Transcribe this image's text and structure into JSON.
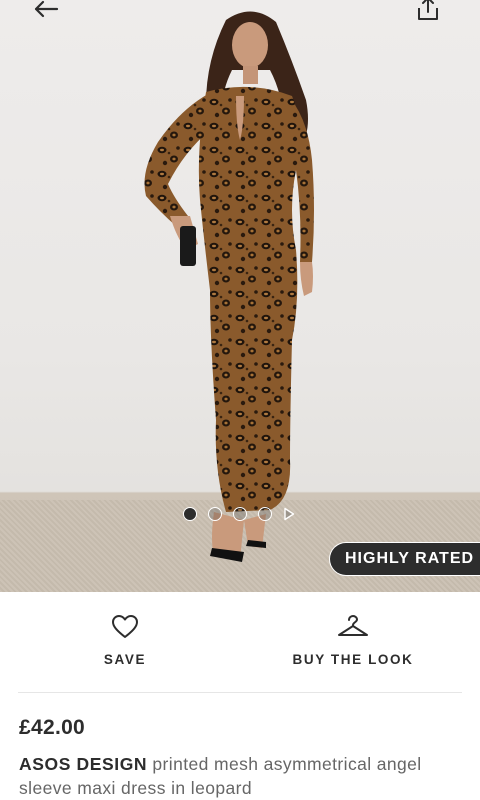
{
  "product": {
    "price": "£42.00",
    "brand": "ASOS DESIGN",
    "name": "printed mesh asymmetrical angel sleeve maxi dress in leopard",
    "badge": "HIGHLY RATED"
  },
  "actions": {
    "save_label": "SAVE",
    "buy_the_look_label": "BUY THE LOOK"
  },
  "gallery": {
    "image_count": 4,
    "active_index": 0,
    "has_video": true
  },
  "icons": {
    "back": "arrow-left-icon",
    "share": "share-icon",
    "save": "heart-icon",
    "look": "hanger-icon"
  }
}
